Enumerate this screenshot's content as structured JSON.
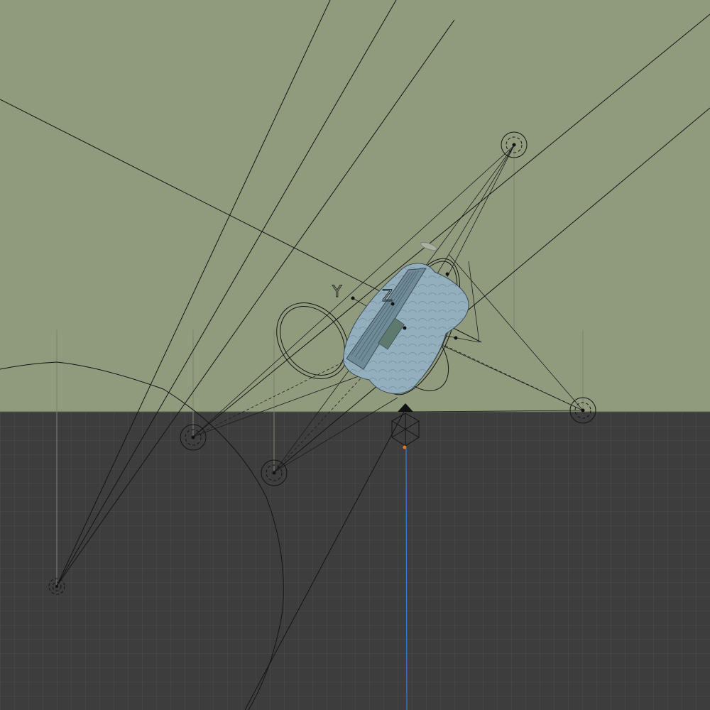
{
  "viewport": {
    "background_color": "#909a7d",
    "floor_color": "#3d3d3d",
    "grid_line_color": "#4a4a4a",
    "wire_color": "#141414",
    "active_axis_color": "#3f7bd9"
  },
  "gizmo": {
    "axis_y_label": "Y",
    "axis_z_label": "Z"
  },
  "objects": [
    {
      "name": "model",
      "icon": "object-mesh-icon",
      "color": "#93aebd"
    },
    {
      "name": "camera",
      "icon": "camera-icon"
    },
    {
      "name": "light",
      "icon": "light-icon",
      "count": 5
    }
  ]
}
